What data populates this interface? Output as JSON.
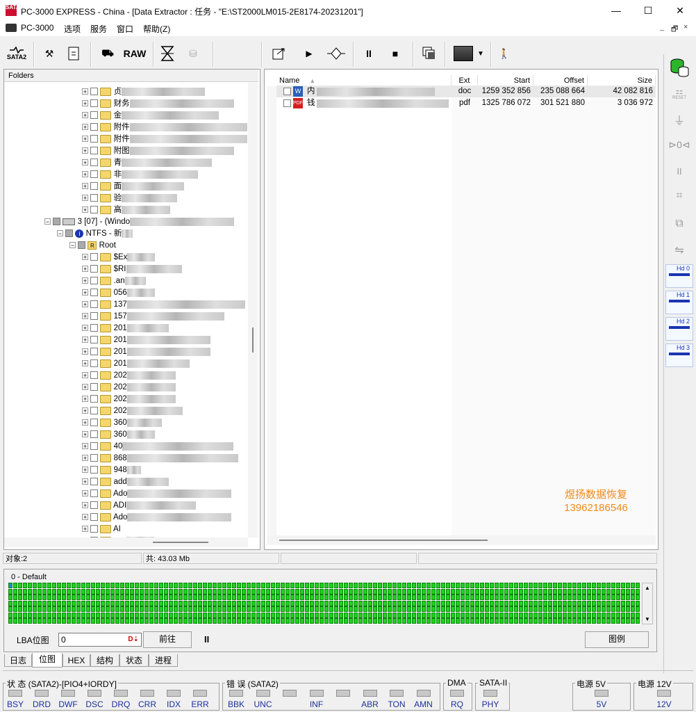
{
  "window": {
    "title": "PC-3000 EXPRESS - China - [Data Extractor : 任务 - \"E:\\ST2000LM015-2E8174-20231201\"]",
    "app_icon_text": "SATA",
    "minimize": "—",
    "maximize": "☐",
    "close": "✕"
  },
  "menu": {
    "items": [
      "PC-3000",
      "选项",
      "服务",
      "窗口",
      "帮助(Z)"
    ],
    "mdi_buttons": [
      "_",
      "🗗",
      "×"
    ]
  },
  "toolbar": {
    "sata_label": "SATA2",
    "raw_label": "RAW"
  },
  "folders": {
    "header": "Folders",
    "rows_top": [
      {
        "label": "贞",
        "blur": 120
      },
      {
        "label": "财务",
        "blur": 150
      },
      {
        "label": "金",
        "blur": 140
      },
      {
        "label": "附件",
        "blur": 170
      },
      {
        "label": "附件",
        "blur": 175
      },
      {
        "label": "附图",
        "blur": 150
      },
      {
        "label": "青",
        "blur": 130
      },
      {
        "label": "非",
        "blur": 110
      },
      {
        "label": "面",
        "blur": 90
      },
      {
        "label": "验",
        "blur": 80
      },
      {
        "label": "高",
        "blur": 70
      }
    ],
    "partition_label": "3 [07] - (Windo",
    "ntfs_label": "NTFS - 新",
    "root_label": "Root",
    "rows_root": [
      {
        "label": "$Ex",
        "blur": 40
      },
      {
        "label": "$RI",
        "blur": 80
      },
      {
        "label": ".an",
        "blur": 30
      },
      {
        "label": "056",
        "blur": 40
      },
      {
        "label": "137",
        "blur": 170
      },
      {
        "label": "157",
        "blur": 140
      },
      {
        "label": "201",
        "blur": 60
      },
      {
        "label": "201",
        "blur": 120
      },
      {
        "label": "201",
        "blur": 120
      },
      {
        "label": "201",
        "blur": 90
      },
      {
        "label": "202",
        "blur": 70
      },
      {
        "label": "202",
        "blur": 70
      },
      {
        "label": "202",
        "blur": 70
      },
      {
        "label": "202",
        "blur": 80
      },
      {
        "label": "360",
        "blur": 50
      },
      {
        "label": "360",
        "blur": 40
      },
      {
        "label": "40",
        "blur": 160
      },
      {
        "label": "868",
        "blur": 160
      },
      {
        "label": "948",
        "blur": 20
      },
      {
        "label": "add",
        "blur": 60
      },
      {
        "label": "Ado",
        "blur": 150
      },
      {
        "label": "ADI",
        "blur": 100
      },
      {
        "label": "Ado",
        "blur": 150
      },
      {
        "label": "AI",
        "blur": 0
      },
      {
        "label": "ans",
        "blur": 40
      }
    ]
  },
  "filelist": {
    "columns": [
      "Name",
      "Ext",
      "Start",
      "Offset",
      "Size"
    ],
    "rows": [
      {
        "name": "内",
        "ext": "doc",
        "start": "1259 352 856",
        "offset": "235 088 664",
        "size": "42 082 816",
        "icon": "word-doc-icon"
      },
      {
        "name": "钱",
        "ext": "pdf",
        "start": "1325 786 072",
        "offset": "301 521 880",
        "size": "3 036 972",
        "icon": "pdf-icon"
      }
    ],
    "watermark_line1": "煜扬数据恢复",
    "watermark_line2": "13962186546"
  },
  "status": {
    "objects": "对象:2",
    "total": "共: 43.03 Mb"
  },
  "bitmap": {
    "label": "0 - Default",
    "cell_color": "#1fd21f"
  },
  "lba": {
    "label": "LBA位图",
    "value": "0",
    "goto_button": "前往",
    "pause_symbol": "II",
    "legend_button": "图例"
  },
  "tabs": [
    "日志",
    "位图",
    "HEX",
    "结构",
    "状态",
    "进程"
  ],
  "bottom": {
    "status_group": "状 态 (SATA2)-[PIO4+IORDY]",
    "status_leds": [
      "BSY",
      "DRD",
      "DWF",
      "DSC",
      "DRQ",
      "CRR",
      "IDX",
      "ERR"
    ],
    "error_group": "错 误 (SATA2)",
    "error_leds": [
      "BBK",
      "UNC",
      "",
      "INF",
      "",
      "ABR",
      "TON",
      "AMN"
    ],
    "dma_group": "DMA",
    "dma_leds": [
      "RQ"
    ],
    "sata_group": "SATA-II",
    "sata_leds": [
      "PHY"
    ],
    "power5_group": "电源 5V",
    "power5_leds": [
      "5V"
    ],
    "power12_group": "电源 12V",
    "power12_leds": [
      "12V"
    ]
  },
  "right_panel": {
    "reset_label": "RESET",
    "hd_labels": [
      "Hd 0",
      "Hd 1",
      "Hd 2",
      "Hd 3"
    ]
  }
}
